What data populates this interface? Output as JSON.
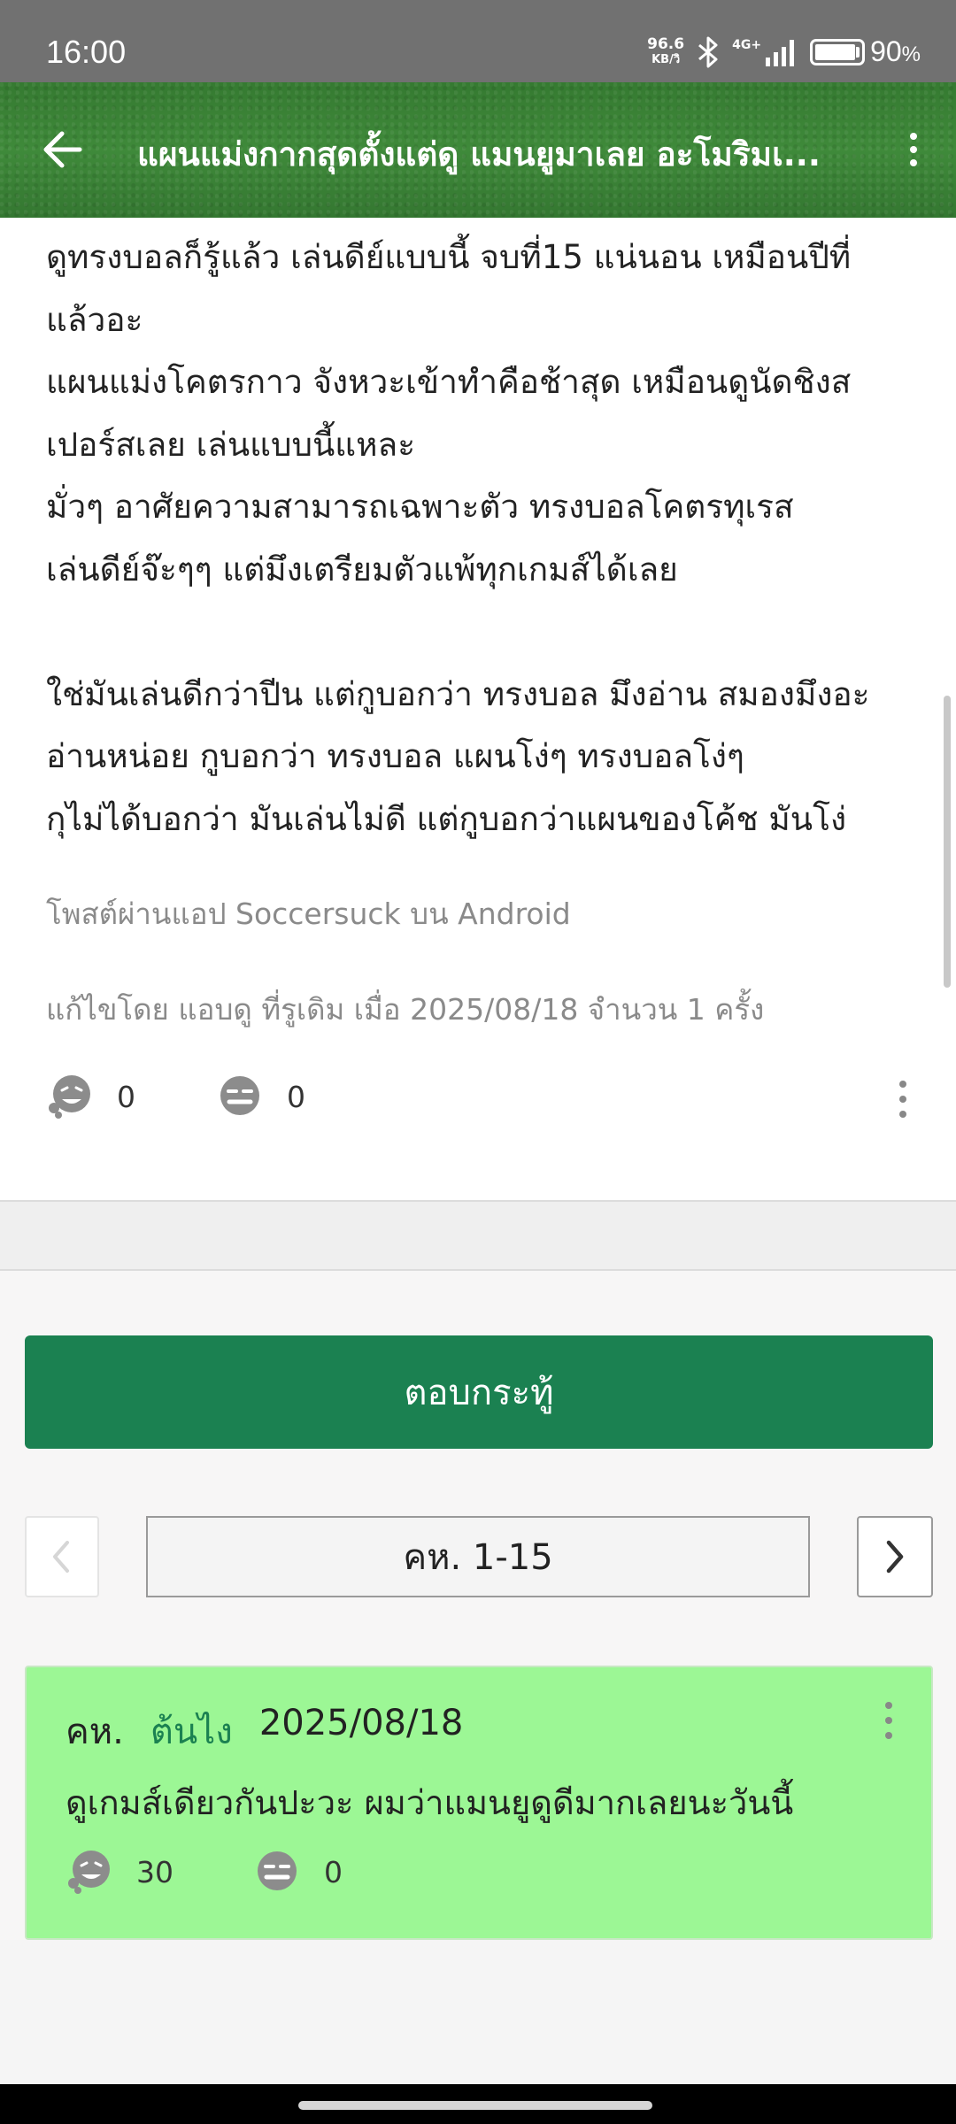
{
  "status_bar": {
    "time": "16:00",
    "net_speed_value": "96.6",
    "net_speed_unit": "KB/วิ",
    "network": "4G+",
    "battery": "90",
    "battery_unit": "%",
    "battery_level": 0.9
  },
  "topbar": {
    "title": "แผนแม่งกากสุดตั้งแต่ดู แมนยูมาเลย อะโมริมเ...",
    "back_icon": "arrow-left-icon",
    "menu_icon": "more-vertical-icon"
  },
  "post": {
    "lines": [
      "ดูทรงบอลก็รู้แล้ว เล่นดีย์แบบนี้ จบที่15 แน่นอน เหมือนปีที่",
      "แล้วอะ",
      "แผนแม่งโคตรกาว จังหวะเข้าทำคือช้าสุด เหมือนดูนัดชิงส",
      "เปอร์สเลย เล่นแบบนี้แหละ",
      "มั่วๆ อาศัยความสามารถเฉพาะตัว ทรงบอลโคตรทุเรส",
      "เล่นดีย์จ๊ะๆๆ แต่มึงเตรียมตัวแพ้ทุกเกมส์ได้เลย",
      "",
      "ใช่มันเล่นดีกว่าปีน แต่กูบอกว่า ทรงบอล มึงอ่าน สมองมึงอะ",
      "อ่านหน่อย กูบอกว่า ทรงบอล แผนโง่ๆ ทรงบอลโง่ๆ",
      "กุไม่ได้บอกว่า มันเล่นไม่ดี แต่กูบอกว่าแผนของโค้ช มันโง่"
    ],
    "posted_via": "โพสต์ผ่านแอป Soccersuck บน Android",
    "edited": "แก้ไขโดย แอบดู ที่รูเดิม เมื่อ 2025/08/18 จำนวน 1 ครั้ง",
    "like_count": "0",
    "dislike_count": "0"
  },
  "reply_button": "ตอบกระทู้",
  "pagination": {
    "label": "คห. 1-15"
  },
  "comment": {
    "prefix": "คห.",
    "user": "ต้นไง",
    "date": "2025/08/18",
    "body": "ดูเกมส์เดียวกันปะวะ ผมว่าแมนยูดูดีมากเลยนะวันนี้",
    "like_count": "30",
    "dislike_count": "0"
  },
  "colors": {
    "reply_button_bg": "#1b8151",
    "comment_bg": "#9cf795",
    "username": "#1b8151"
  }
}
